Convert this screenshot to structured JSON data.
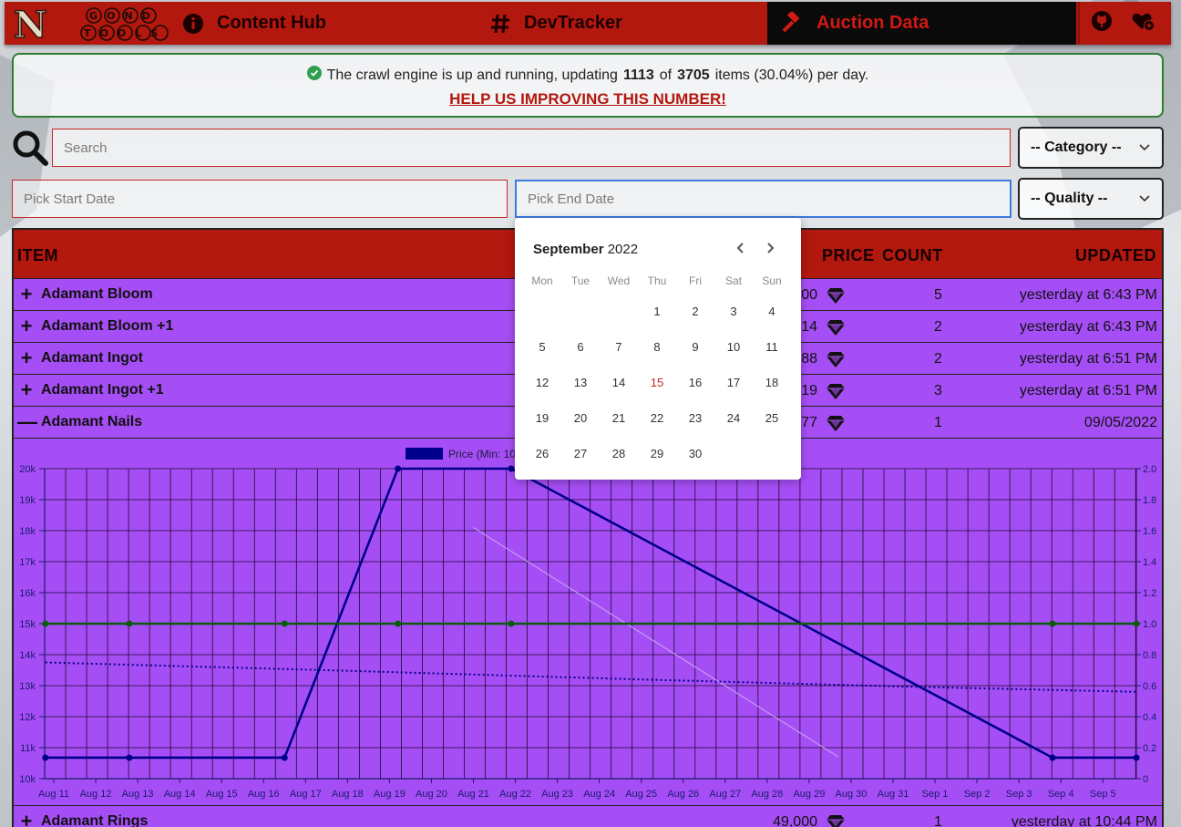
{
  "nav": {
    "logo_text": "N GOND TOOLS",
    "items": [
      {
        "label": "Content Hub",
        "icon": "info-circle-icon"
      },
      {
        "label": "DevTracker",
        "icon": "hash-icon"
      },
      {
        "label": "Auction Data",
        "icon": "gavel-icon",
        "active": true
      }
    ],
    "right_icons": [
      "github-icon",
      "heart-plus-icon"
    ],
    "colors": {
      "bar": "#b3180f",
      "active_bg": "#0a0a0a",
      "active_text": "#d21a12"
    }
  },
  "notice": {
    "prefix": "The crawl engine is up and running, updating",
    "updated": "1113",
    "of": "of",
    "total": "3705",
    "suffix": "items (30.04%) per day.",
    "cta": "HELP US IMPROVING THIS NUMBER!"
  },
  "filters": {
    "search_placeholder": "Search",
    "category": "-- Category --",
    "quality": "-- Quality --",
    "start_placeholder": "Pick Start Date",
    "end_placeholder": "Pick End Date"
  },
  "table": {
    "headers": {
      "item": "ITEM",
      "price": "PRICE",
      "count": "COUNT",
      "updated": "UPDATED"
    },
    "rows": [
      {
        "name": "Adamant Bloom",
        "toggle": "+",
        "price": "1,500",
        "count": "5",
        "updated": "yesterday at 6:43 PM"
      },
      {
        "name": "Adamant Bloom +1",
        "toggle": "+",
        "price": "6,314",
        "count": "2",
        "updated": "yesterday at 6:43 PM"
      },
      {
        "name": "Adamant Ingot",
        "toggle": "+",
        "price": "53,288",
        "count": "2",
        "updated": "yesterday at 6:51 PM"
      },
      {
        "name": "Adamant Ingot +1",
        "toggle": "+",
        "price": "57,019",
        "count": "3",
        "updated": "yesterday at 6:51 PM"
      },
      {
        "name": "Adamant Nails",
        "toggle": "—",
        "price": "10,677",
        "count": "1",
        "updated": "09/05/2022"
      }
    ],
    "last_row": {
      "name": "Adamant Rings",
      "toggle": "+",
      "price": "49,000",
      "count": "1",
      "updated": "yesterday at 10:44 PM"
    },
    "row_bg": "#a64ef5",
    "header_bg": "#b3180f"
  },
  "datepicker": {
    "month": "September",
    "year": "2022",
    "weekdays": [
      "Mon",
      "Tue",
      "Wed",
      "Thu",
      "Fri",
      "Sat",
      "Sun"
    ],
    "weeks": [
      [
        "",
        "",
        "",
        "1",
        "2",
        "3",
        "4"
      ],
      [
        "5",
        "6",
        "7",
        "8",
        "9",
        "10",
        "11"
      ],
      [
        "12",
        "13",
        "14",
        "15",
        "16",
        "17",
        "18"
      ],
      [
        "19",
        "20",
        "21",
        "22",
        "23",
        "24",
        "25"
      ],
      [
        "26",
        "27",
        "28",
        "29",
        "30",
        "",
        ""
      ]
    ],
    "today": "15"
  },
  "chart_data": {
    "type": "line",
    "legend": [
      {
        "name": "Price (Min: 10",
        "color": "#00008b"
      }
    ],
    "x": [
      "Aug 11",
      "Aug 12",
      "Aug 13",
      "Aug 14",
      "Aug 15",
      "Aug 16",
      "Aug 17",
      "Aug 18",
      "Aug 19",
      "Aug 20",
      "Aug 21",
      "Aug 22",
      "Aug 23",
      "Aug 24",
      "Aug 25",
      "Aug 26",
      "Aug 27",
      "Aug 28",
      "Aug 29",
      "Aug 30",
      "Aug 31",
      "Sep 1",
      "Sep 2",
      "Sep 3",
      "Sep 4",
      "Sep 5"
    ],
    "y_left_ticks": [
      "10k",
      "11k",
      "12k",
      "13k",
      "14k",
      "15k",
      "16k",
      "17k",
      "18k",
      "19k",
      "20k"
    ],
    "y_right_ticks": [
      "0",
      "0.2",
      "0.4",
      "0.6",
      "0.8",
      "1.0",
      "1.2",
      "1.4",
      "1.6",
      "1.8",
      "2.0"
    ],
    "ylim_left": [
      10000,
      20000
    ],
    "ylim_right": [
      0,
      2
    ],
    "series": [
      {
        "name": "Price",
        "axis": "left",
        "color": "#00008b",
        "points": [
          [
            10.8,
            10677
          ],
          [
            12.8,
            10677
          ],
          [
            16.5,
            10677
          ],
          [
            19.2,
            20000
          ],
          [
            21.9,
            20000
          ],
          [
            34.8,
            10677
          ],
          [
            36.8,
            10677
          ]
        ]
      },
      {
        "axis": "right",
        "color": "#0a5c0a",
        "points": [
          [
            10.8,
            1.0
          ],
          [
            12.8,
            1.0
          ],
          [
            16.5,
            1.0
          ],
          [
            19.2,
            1.0
          ],
          [
            21.9,
            1.0
          ],
          [
            34.8,
            1.0
          ],
          [
            36.8,
            1.0
          ]
        ]
      },
      {
        "axis": "left",
        "color": "#00008b",
        "dotted": true,
        "points": [
          [
            10.8,
            13750
          ],
          [
            18,
            13480
          ],
          [
            25,
            13200
          ],
          [
            31,
            12980
          ],
          [
            36.8,
            12800
          ]
        ]
      }
    ],
    "grid": true
  }
}
